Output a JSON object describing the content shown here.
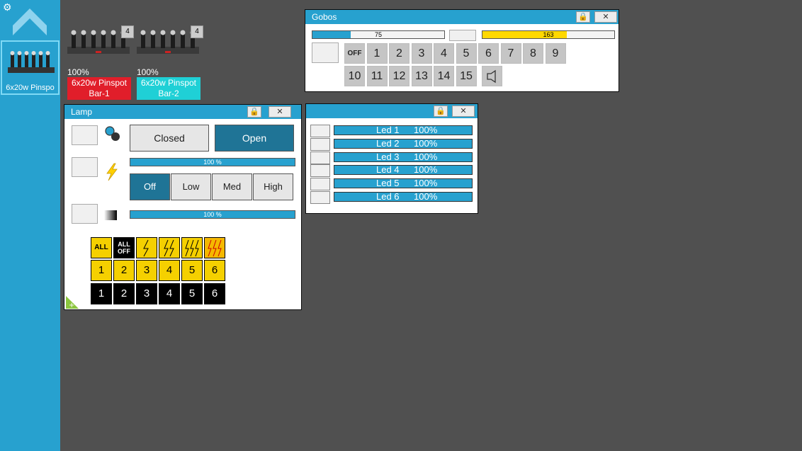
{
  "sidebar": {
    "fixture_label": "6x20w Pinspo",
    "icons": [
      "gear-icon",
      "up-arrow-icon"
    ]
  },
  "fixtures": [
    {
      "name_line1": "6x20w Pinspot",
      "name_line2": "Bar-1",
      "percent": "100%",
      "badge": "4",
      "color": "#e11e2a"
    },
    {
      "name_line1": "6x20w Pinspot",
      "name_line2": "Bar-2",
      "percent": "100%",
      "badge": "4",
      "color": "#1fd0d6"
    }
  ],
  "gobos": {
    "title": "Gobos",
    "slider1_value": "75",
    "slider1_fraction": 0.29,
    "slider2_value": "163",
    "slider2_fraction": 0.64,
    "slider2_color": "#ffd800",
    "buttons_row1": [
      "OFF",
      "1",
      "2",
      "3",
      "4",
      "5",
      "6",
      "7",
      "8",
      "9"
    ],
    "buttons_row2": [
      "10",
      "11",
      "12",
      "13",
      "14",
      "15"
    ]
  },
  "lamp": {
    "title": "Lamp",
    "closed_label": "Closed",
    "open_label": "Open",
    "intensity_value": "100 %",
    "intensity_fraction": 1.0,
    "strobe_buttons": [
      "Off",
      "Low",
      "Med",
      "High"
    ],
    "dimmer_value": "100 %",
    "dimmer_fraction": 1.0,
    "all_label": "ALL",
    "all_off_label": "ALL OFF",
    "yellow_row": [
      "1",
      "2",
      "3",
      "4",
      "5",
      "6"
    ],
    "black_row": [
      "1",
      "2",
      "3",
      "4",
      "5",
      "6"
    ]
  },
  "leds": {
    "rows": [
      {
        "label": "Led 1",
        "value": "100%"
      },
      {
        "label": "Led 2",
        "value": "100%"
      },
      {
        "label": "Led 3",
        "value": "100%"
      },
      {
        "label": "Led 4",
        "value": "100%"
      },
      {
        "label": "Led 5",
        "value": "100%"
      },
      {
        "label": "Led 6",
        "value": "100%"
      }
    ]
  },
  "colors": {
    "accent": "#27a1cf",
    "active_button": "#1f7496",
    "desktop": "#505050"
  }
}
